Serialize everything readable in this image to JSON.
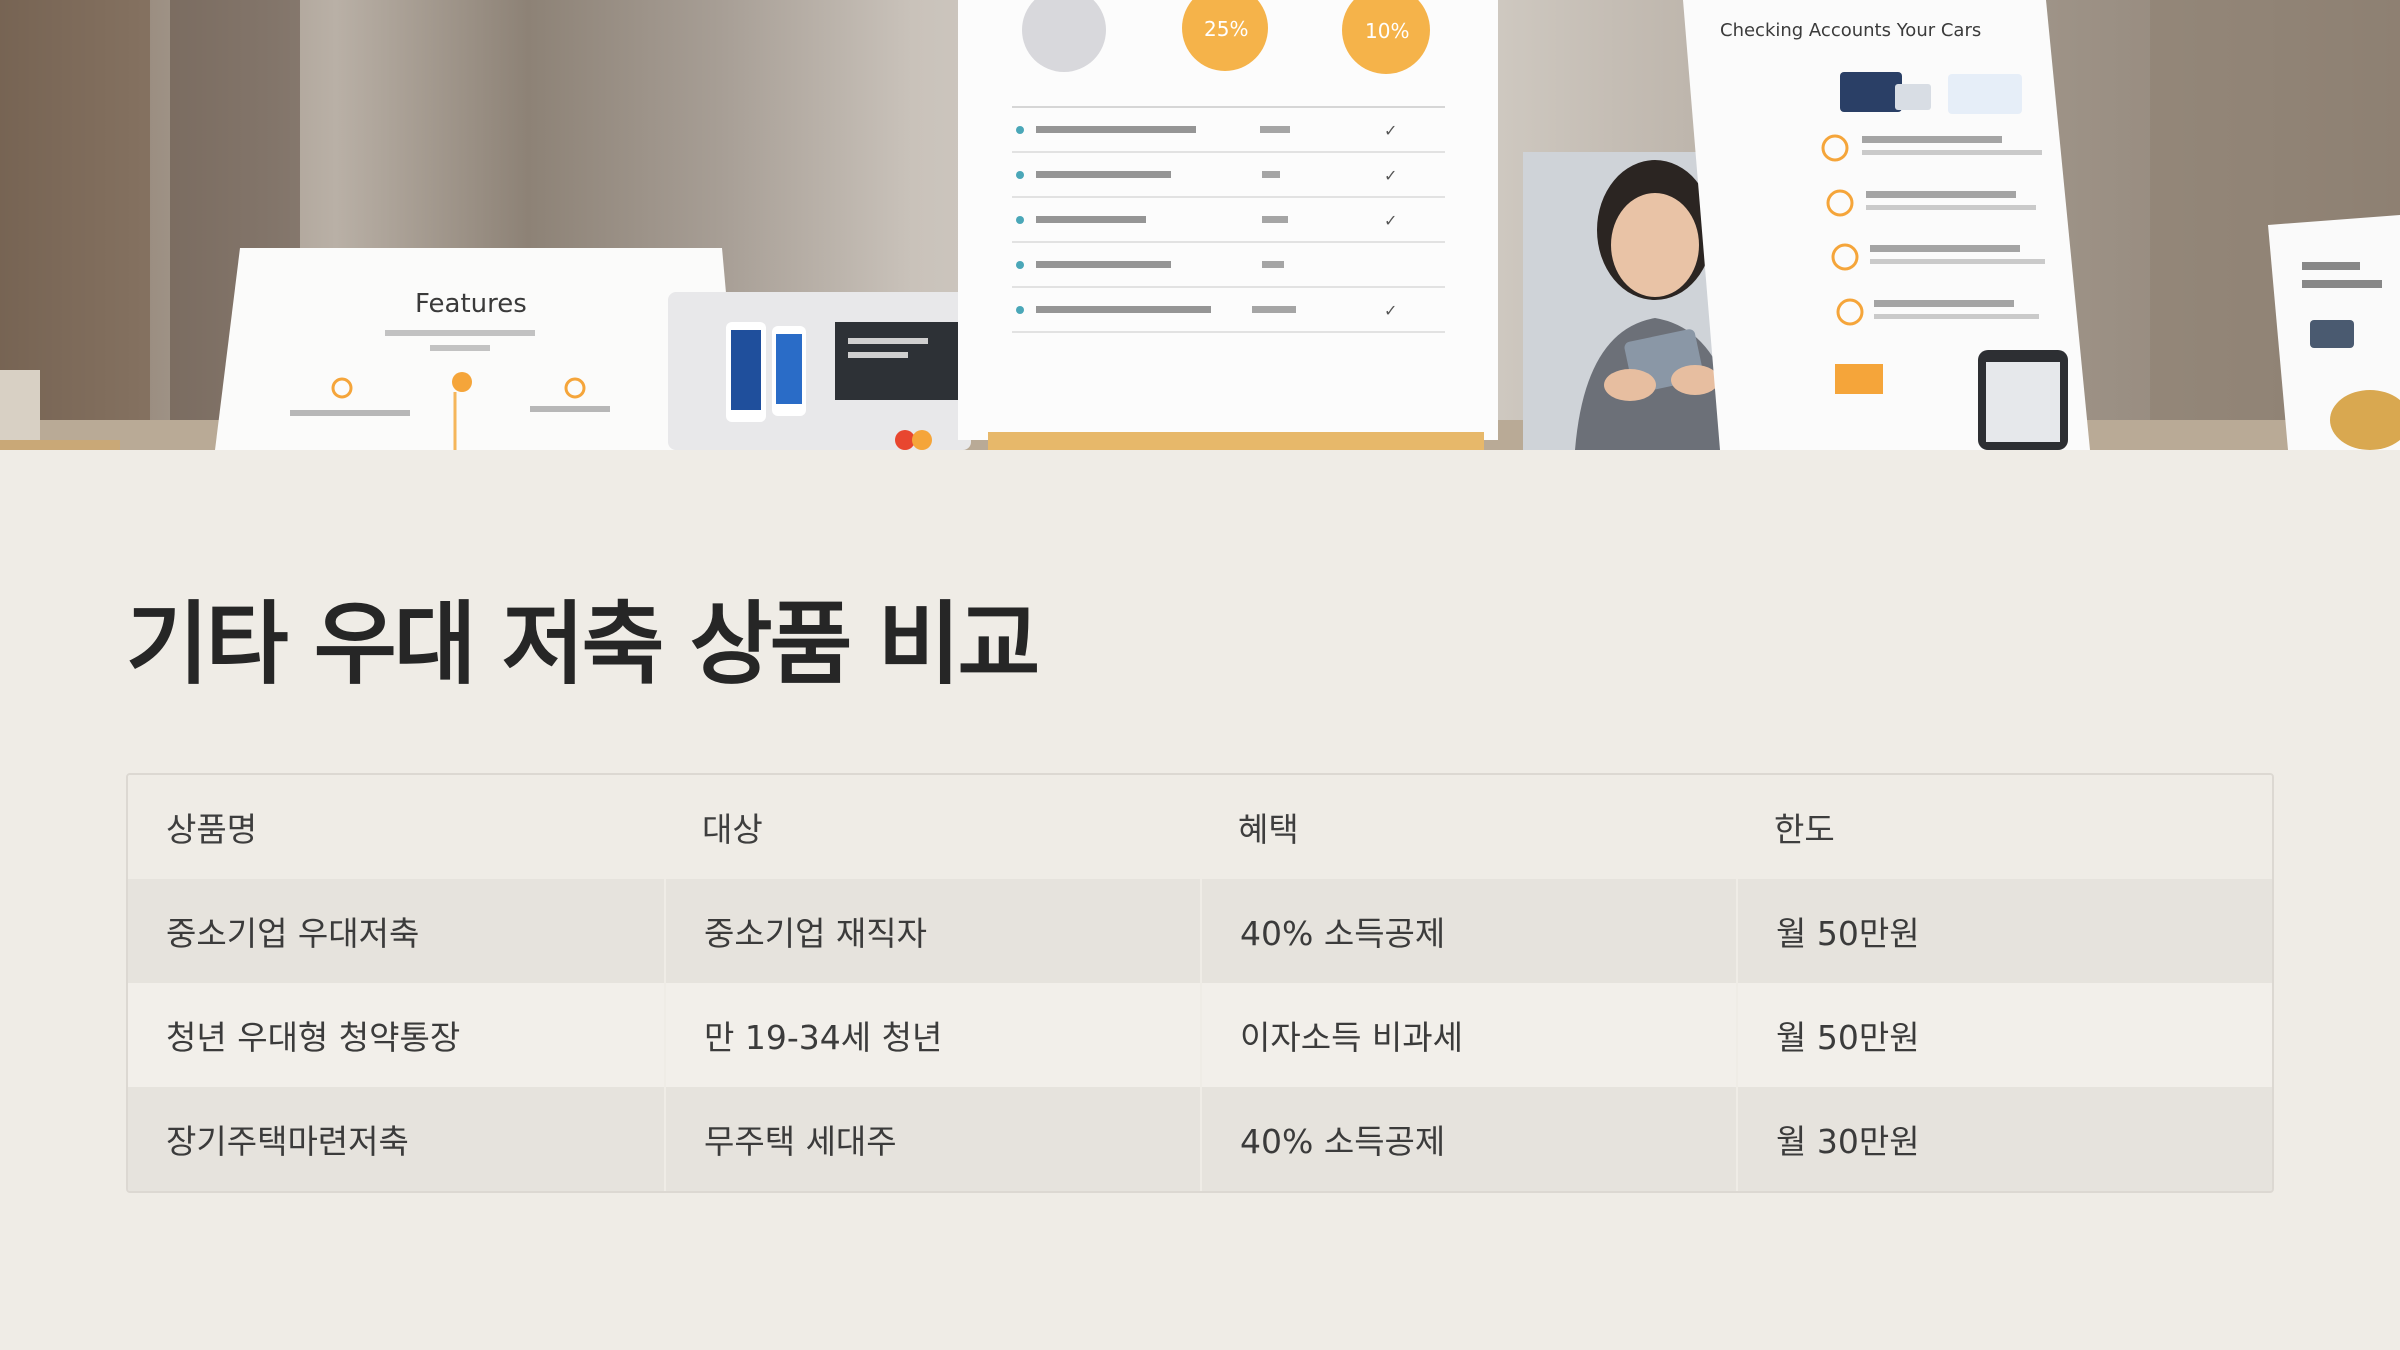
{
  "title": "기타 우대 저축 상품 비교",
  "table": {
    "headers": [
      "상품명",
      "대상",
      "혜택",
      "한도"
    ],
    "rows": [
      [
        "중소기업 우대저축",
        "중소기업 재직자",
        "40% 소득공제",
        "월 50만원"
      ],
      [
        "청년 우대형 청약통장",
        "만 19-34세 청년",
        "이자소득 비과세",
        "월 50만원"
      ],
      [
        "장기주택마련저축",
        "무주택 세대주",
        "40% 소득공제",
        "월 30만원"
      ]
    ]
  },
  "banner": {
    "features_card_title": "Features",
    "center_card_badges": [
      "25%",
      "10%"
    ],
    "right_card_heading": "Checking Accounts\nYour Cars"
  },
  "colors": {
    "background": "#efece6",
    "title": "#262626",
    "row_shade": "#e6e3dd",
    "row_plain": "#f2efea",
    "accent_orange": "#f5a53a"
  }
}
